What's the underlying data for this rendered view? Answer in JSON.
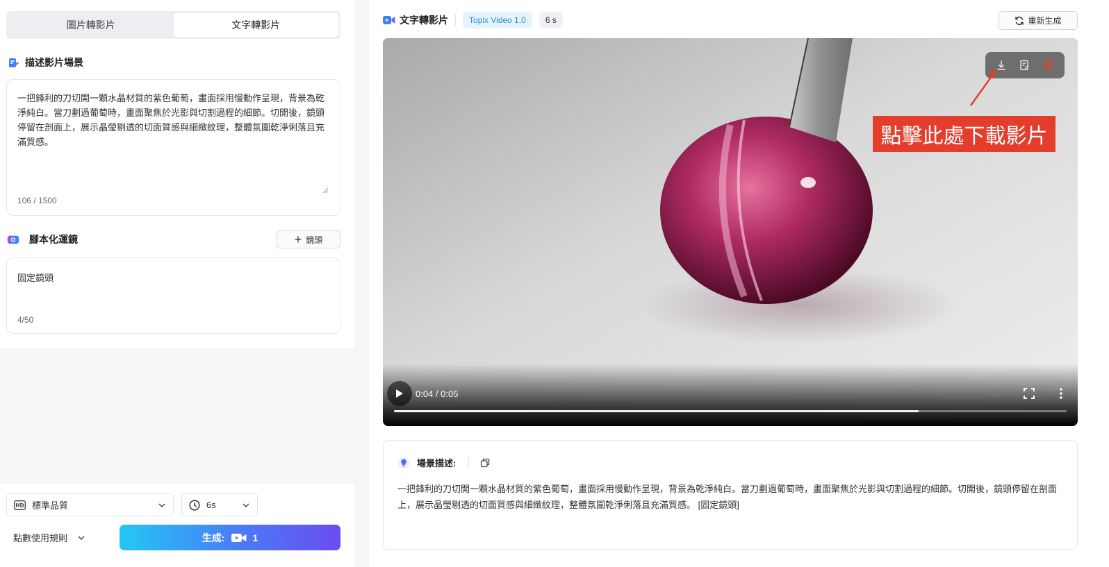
{
  "tabs": [
    {
      "label": "圖片轉影片",
      "active": false
    },
    {
      "label": "文字轉影片",
      "active": true
    }
  ],
  "describe": {
    "heading": "描述影片場景",
    "text": "一把鋒利的刀切開一顆水晶材質的紫色葡萄，畫面採用慢動作呈現，背景為乾淨純白。當刀劃過葡萄時，畫面聚焦於光影與切割過程的細節。切開後，鏡頭停留在剖面上，展示晶瑩剔透的切面質感與細緻紋理，整體氛圍乾淨俐落且充滿質感。",
    "count": "106 / 1500"
  },
  "camera": {
    "heading": "腳本化運鏡",
    "add_label": "鏡頭",
    "text": "固定鏡頭",
    "count": "4/50"
  },
  "bottom": {
    "quality": "標準品質",
    "duration": "6s",
    "points_rule": "點數使用規則",
    "generate_label": "生成:",
    "generate_count": "1"
  },
  "header": {
    "title": "文字轉影片",
    "model": "Topix Video 1.0",
    "duration": "6 s",
    "regenerate": "重新生成"
  },
  "player": {
    "time": "0:04 / 0:05",
    "progress": 0.78
  },
  "annotation": {
    "callout": "點擊此處下載影片"
  },
  "scene": {
    "heading": "場景描述:",
    "text": "一把鋒利的刀切開一顆水晶材質的紫色葡萄，畫面採用慢動作呈現，背景為乾淨純白。當刀劃過葡萄時，畫面聚焦於光影與切割過程的細節。切開後，鏡頭停留在剖面上，展示晶瑩剔透的切面質感與細緻紋理，整體氛圍乾淨俐落且充滿質感。 [固定鏡頭]"
  },
  "colors": {
    "accent_red": "#e33d2c",
    "model_blue": "#1e8fd0",
    "gradient_start": "#22c8f5",
    "gradient_end": "#6b4cf0"
  },
  "icons": [
    "edit-doc-icon",
    "camera-icon",
    "plus-icon",
    "hd-icon",
    "clock-icon",
    "chevron-down-icon",
    "video-camera-icon",
    "refresh-icon",
    "download-icon",
    "edit-icon",
    "delete-icon",
    "play-icon",
    "volume-icon",
    "fullscreen-icon",
    "more-icon",
    "lightbulb-icon",
    "copy-icon"
  ]
}
